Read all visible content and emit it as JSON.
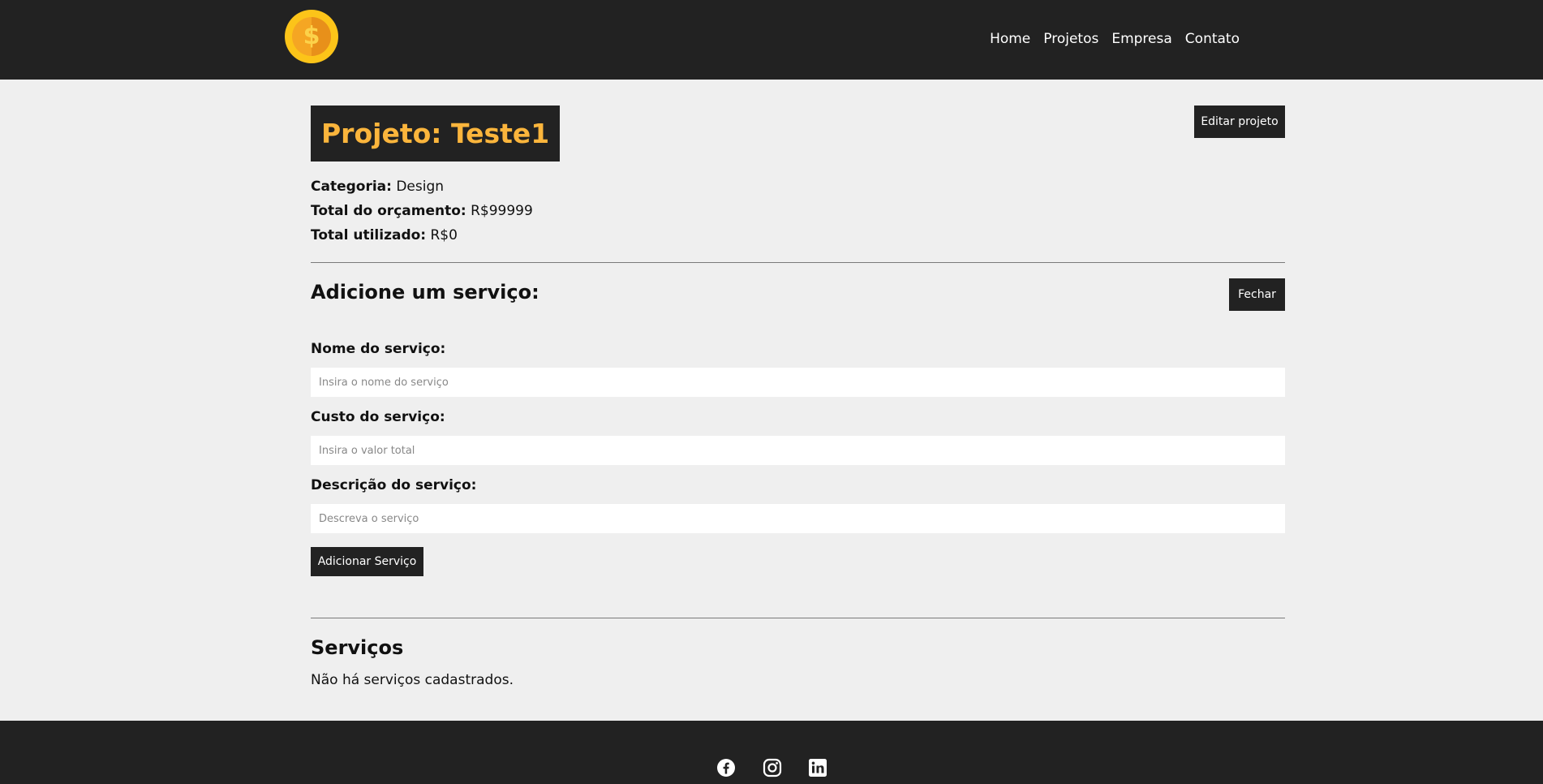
{
  "nav": {
    "logo": "coin-logo",
    "links": [
      "Home",
      "Projetos",
      "Empresa",
      "Contato"
    ]
  },
  "project": {
    "title": "Projeto: Teste1",
    "edit_label": "Editar projeto",
    "category_label": "Categoria:",
    "category_value": "Design",
    "budget_label": "Total do orçamento:",
    "budget_value": "R$99999",
    "used_label": "Total utilizado:",
    "used_value": "R$0"
  },
  "service_form": {
    "heading": "Adicione um serviço:",
    "close_label": "Fechar",
    "name_label": "Nome do serviço:",
    "name_placeholder": "Insira o nome do serviço",
    "cost_label": "Custo do serviço:",
    "cost_placeholder": "Insira o valor total",
    "description_label": "Descrição do serviço:",
    "description_placeholder": "Descreva o serviço",
    "submit_label": "Adicionar Serviço"
  },
  "services": {
    "heading": "Serviços",
    "empty_message": "Não há serviços cadastrados."
  },
  "footer": {
    "icons": [
      "facebook-icon",
      "instagram-icon",
      "linkedin-icon"
    ]
  },
  "colors": {
    "dark": "#222222",
    "accent": "#fbb53c",
    "background": "#efefef"
  }
}
